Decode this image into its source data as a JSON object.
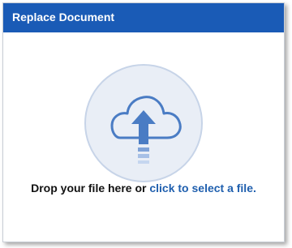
{
  "dialog": {
    "title": "Replace Document",
    "drop_text": "Drop your file here or",
    "select_link": "click to select a file."
  },
  "icons": {
    "upload": "cloud-upload-icon"
  },
  "colors": {
    "title_bar": "#1a5bb6",
    "link": "#1f5fae",
    "icon_blue": "#4a7cc4",
    "circle_fill": "#e9eef6",
    "circle_border": "#c7d4e8"
  }
}
